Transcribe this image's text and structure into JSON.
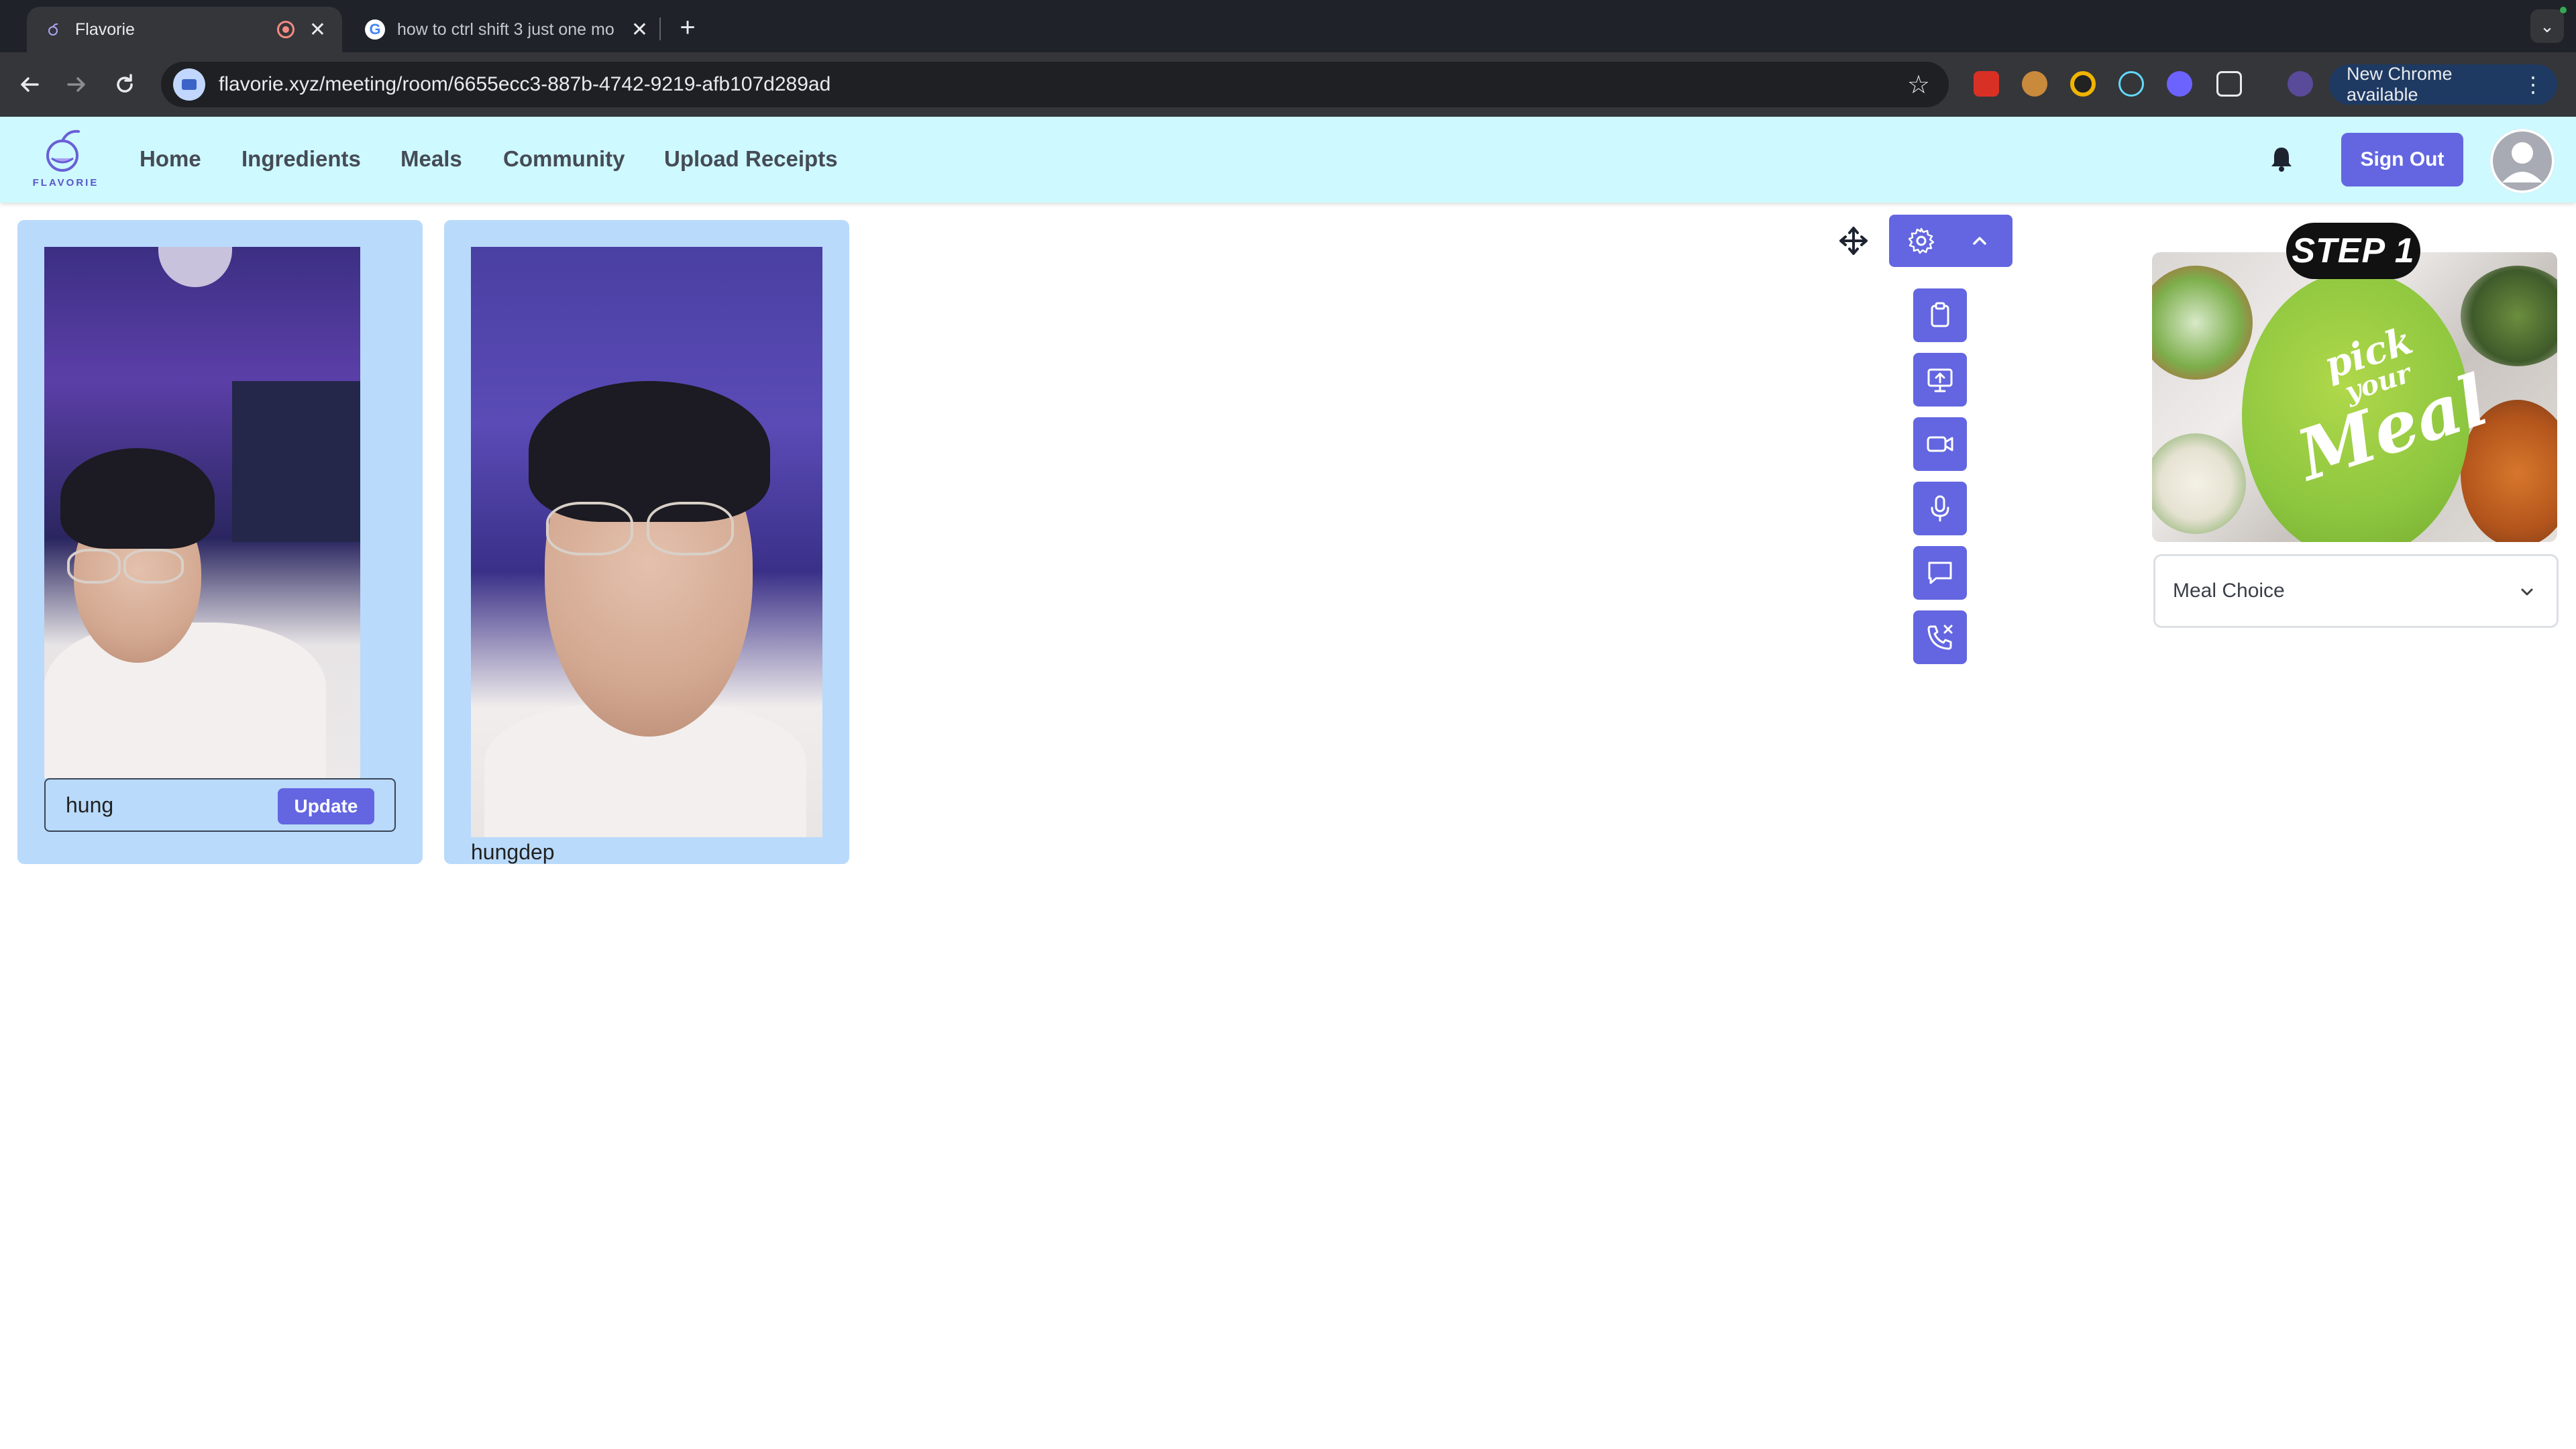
{
  "browser": {
    "tabs": [
      {
        "title": "Flavorie",
        "active": true,
        "recording": true
      },
      {
        "title": "how to ctrl shift 3 just one mo",
        "active": false
      }
    ],
    "new_tab_label": "+",
    "url": "flavorie.xyz/meeting/room/6655ecc3-887b-4742-9219-afb107d289ad",
    "update_label": "New Chrome available"
  },
  "nav": {
    "logo_text": "FLAVORIE",
    "links": [
      "Home",
      "Ingredients",
      "Meals",
      "Community",
      "Upload Receipts"
    ],
    "sign_out": "Sign Out"
  },
  "participants": [
    {
      "name_input_value": "hung",
      "update_label": "Update"
    },
    {
      "name": "hungdep"
    }
  ],
  "controls": {
    "icons": [
      "move-icon",
      "gear-icon",
      "chevron-up-icon",
      "clipboard-icon",
      "screen-share-icon",
      "video-icon",
      "microphone-icon",
      "chat-icon",
      "end-call-icon"
    ]
  },
  "step": {
    "badge": "STEP 1",
    "art_text": [
      "pick",
      "your",
      "Meal"
    ],
    "select_value": "Meal Choice"
  },
  "colors": {
    "accent": "#6366e0",
    "nav_bg": "#cdf9ff",
    "tile_bg": "#b9dafb"
  }
}
